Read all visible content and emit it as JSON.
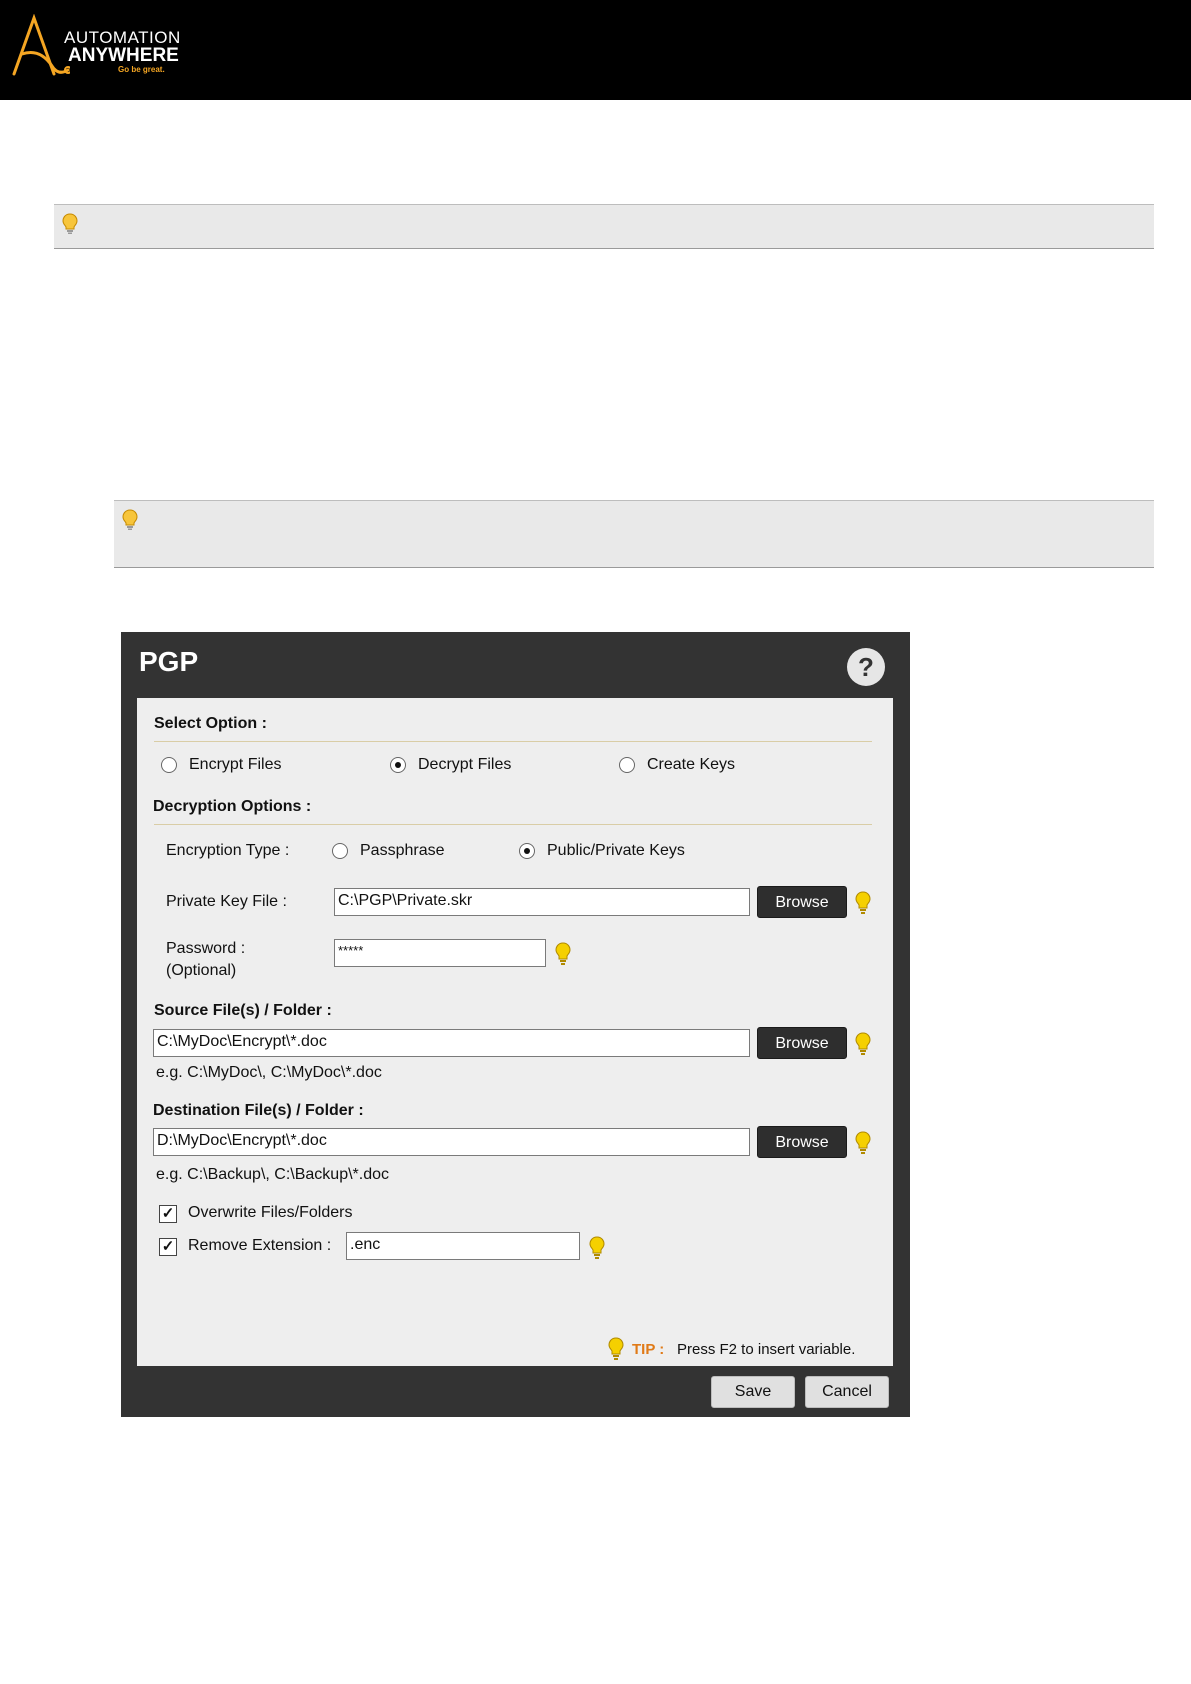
{
  "brand": {
    "line1": "AUTOMATION",
    "line2": "ANYWHERE",
    "tagline": "Go be great."
  },
  "notes": [
    {
      "icon": "lightbulb-icon"
    },
    {
      "icon": "lightbulb-icon"
    }
  ],
  "dialog": {
    "title": "PGP",
    "help_label": "?",
    "select_option_heading": "Select Option :",
    "options": [
      {
        "label": "Encrypt Files",
        "selected": false
      },
      {
        "label": "Decrypt Files",
        "selected": true
      },
      {
        "label": "Create Keys",
        "selected": false
      }
    ],
    "decryption_heading": "Decryption Options :",
    "encryption_type_label": "Encryption Type :",
    "encryption_types": [
      {
        "label": "Passphrase",
        "selected": false
      },
      {
        "label": "Public/Private Keys",
        "selected": true
      }
    ],
    "private_key_label": "Private Key File :",
    "private_key_value": "C:\\PGP\\Private.skr",
    "password_label_1": "Password :",
    "password_label_2": "(Optional)",
    "password_value": "*****",
    "source_heading": "Source File(s) / Folder :",
    "source_value": "C:\\MyDoc\\Encrypt\\*.doc",
    "source_example": "e.g. C:\\MyDoc\\, C:\\MyDoc\\*.doc",
    "destination_heading": "Destination File(s) / Folder :",
    "destination_value": "D:\\MyDoc\\Encrypt\\*.doc",
    "destination_example": "e.g. C:\\Backup\\, C:\\Backup\\*.doc",
    "browse_label": "Browse",
    "overwrite_label": "Overwrite Files/Folders",
    "overwrite_checked": true,
    "remove_ext_label": "Remove Extension :",
    "remove_ext_checked": true,
    "remove_ext_value": ".enc",
    "check_mark": "✓",
    "tip_label": "TIP :",
    "tip_text": "Press F2 to insert variable.",
    "save_label": "Save",
    "cancel_label": "Cancel"
  },
  "colors": {
    "header_bg": "#000000",
    "dialog_bg": "#333333",
    "panel_bg": "#eeeeee",
    "bulb": "#f2c200",
    "tip_accent": "#e07a17",
    "brand_orange": "#f5a623"
  }
}
